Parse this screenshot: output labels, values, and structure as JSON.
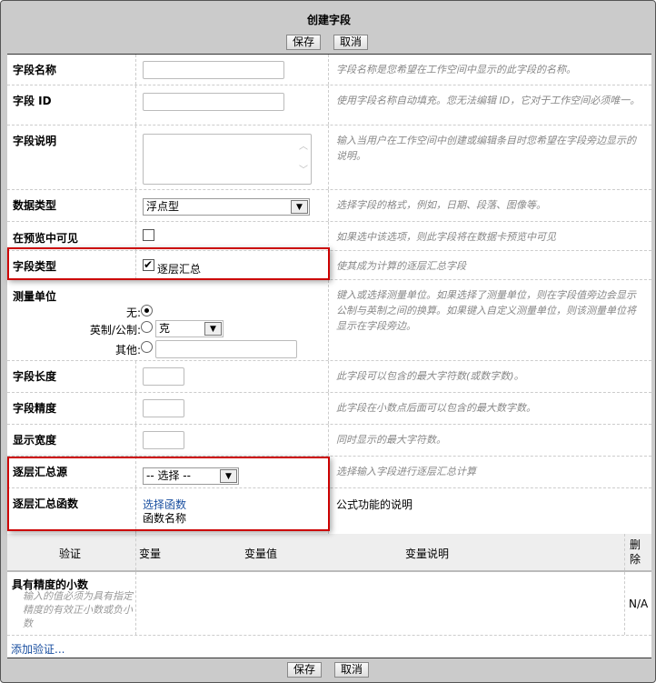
{
  "dialog": {
    "title": "创建字段",
    "save_label": "保存",
    "cancel_label": "取消"
  },
  "fields": {
    "name": {
      "label": "字段名称",
      "value": "",
      "desc": "字段名称是您希望在工作空间中显示的此字段的名称。"
    },
    "id": {
      "label": "字段 ID",
      "value": "",
      "desc": "使用字段名称自动填充。您无法编辑 ID，它对于工作空间必须唯一。"
    },
    "description": {
      "label": "字段说明",
      "value": "",
      "desc": "输入当用户在工作空间中创建或编辑条目时您希望在字段旁边显示的说明。"
    },
    "data_type": {
      "label": "数据类型",
      "value": "浮点型",
      "desc": "选择字段的格式，例如，日期、段落、图像等。"
    },
    "visible_in_preview": {
      "label": "在预览中可见",
      "checked": false,
      "desc": "如果选中该选项，则此字段将在数据卡预览中可见"
    },
    "field_type": {
      "label": "字段类型",
      "option_label": "逐层汇总",
      "checked": true,
      "desc": "使其成为计算的逐层汇总字段"
    },
    "unit": {
      "label": "测量单位",
      "none_label": "无:",
      "metric_label": "英制/公制:",
      "metric_value": "克",
      "other_label": "其他:",
      "other_value": "",
      "selected": "none",
      "desc": "键入或选择测量单位。如果选择了测量单位，则在字段值旁边会显示公制与英制之间的换算。如果键入自定义测量单位，则该测量单位将显示在字段旁边。"
    },
    "length": {
      "label": "字段长度",
      "value": "",
      "desc": "此字段可以包含的最大字符数(或数字数)。"
    },
    "precision": {
      "label": "字段精度",
      "value": "",
      "desc": "此字段在小数点后面可以包含的最大数字数。"
    },
    "display_width": {
      "label": "显示宽度",
      "value": "",
      "desc": "同时显示的最大字符数。"
    },
    "rollup_source": {
      "label": "逐层汇总源",
      "value": "-- 选择 --",
      "desc": "选择输入字段进行逐层汇总计算"
    },
    "rollup_function": {
      "label": "逐层汇总函数",
      "link": "选择函数",
      "name": "函数名称",
      "desc": "公式功能的说明"
    }
  },
  "validation": {
    "headers": {
      "validation": "验证",
      "variable": "变量",
      "variable_value": "变量值",
      "variable_desc": "变量说明",
      "delete": "删除"
    },
    "rows": [
      {
        "name": "具有精度的小数",
        "desc": "输入的值必须为具有指定精度的有效正小数或负小数",
        "delete": "N/A"
      }
    ],
    "add_link": "添加验证..."
  },
  "colors": {
    "highlight": "#cc0000",
    "link": "#1a4fa0"
  }
}
